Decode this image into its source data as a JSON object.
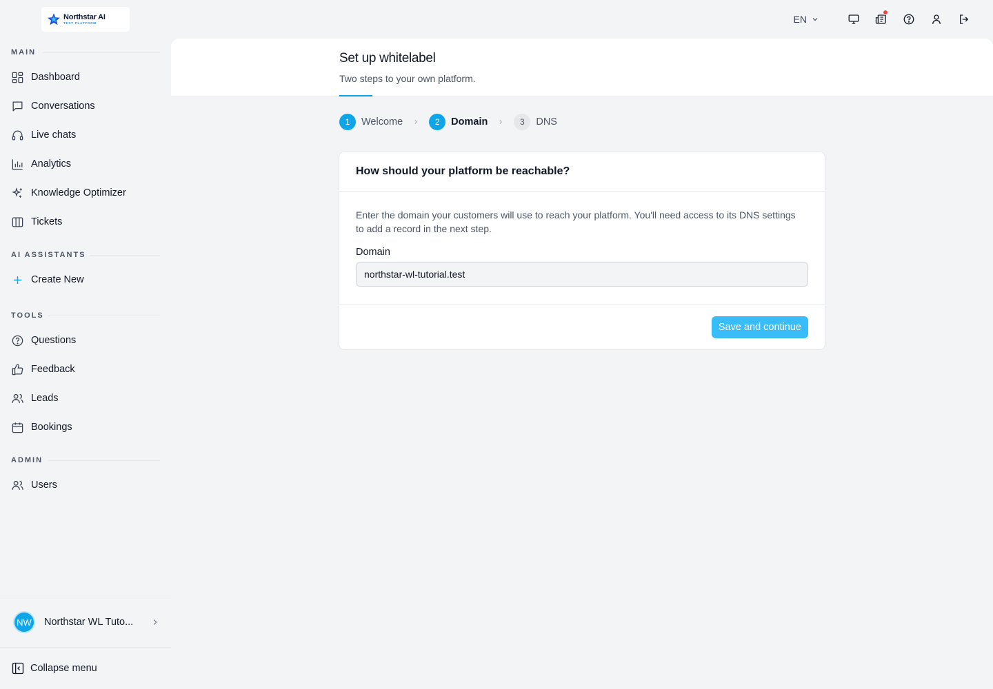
{
  "brand": {
    "name": "Northstar AI",
    "tagline": "TEST PLATFORM",
    "accent": "#0ea5e9",
    "logo_star_color": "#1e4fd8"
  },
  "sidebar": {
    "sections": [
      {
        "label": "MAIN"
      },
      {
        "label": "AI ASSISTANTS"
      },
      {
        "label": "TOOLS"
      },
      {
        "label": "ADMIN"
      }
    ],
    "main_items": [
      {
        "label": "Dashboard",
        "icon": "dashboard-icon"
      },
      {
        "label": "Conversations",
        "icon": "chat-bubble-icon"
      },
      {
        "label": "Live chats",
        "icon": "headphones-icon"
      },
      {
        "label": "Analytics",
        "icon": "bar-chart-icon"
      },
      {
        "label": "Knowledge Optimizer",
        "icon": "sparkles-icon"
      },
      {
        "label": "Tickets",
        "icon": "columns-icon"
      }
    ],
    "assistant_items": [
      {
        "label": "Create New",
        "icon": "plus-icon"
      }
    ],
    "tools_items": [
      {
        "label": "Questions",
        "icon": "question-circle-icon"
      },
      {
        "label": "Feedback",
        "icon": "thumbs-up-icon"
      },
      {
        "label": "Leads",
        "icon": "users-icon"
      },
      {
        "label": "Bookings",
        "icon": "calendar-icon"
      }
    ],
    "admin_items": [
      {
        "label": "Users",
        "icon": "users-icon"
      }
    ],
    "account": {
      "initials": "NW",
      "name": "Northstar WL Tuto..."
    },
    "collapse_label": "Collapse menu"
  },
  "topbar": {
    "language": "EN",
    "icons": [
      "monitor-icon",
      "news-icon",
      "help-icon",
      "user-icon",
      "logout-icon"
    ],
    "notification_color": "#ef4444"
  },
  "page": {
    "title": "Set up whitelabel",
    "subtitle": "Two steps to your own platform."
  },
  "stepper": {
    "steps": [
      {
        "number": "1",
        "label": "Welcome",
        "state": "done"
      },
      {
        "number": "2",
        "label": "Domain",
        "state": "current"
      },
      {
        "number": "3",
        "label": "DNS",
        "state": "pending"
      }
    ]
  },
  "card": {
    "title": "How should your platform be reachable?",
    "description": "Enter the domain your customers will use to reach your platform. You'll need access to its DNS settings to add a record in the next step.",
    "field_label": "Domain",
    "field_value": "northstar-wl-tutorial.test",
    "submit_label": "Save and continue"
  }
}
